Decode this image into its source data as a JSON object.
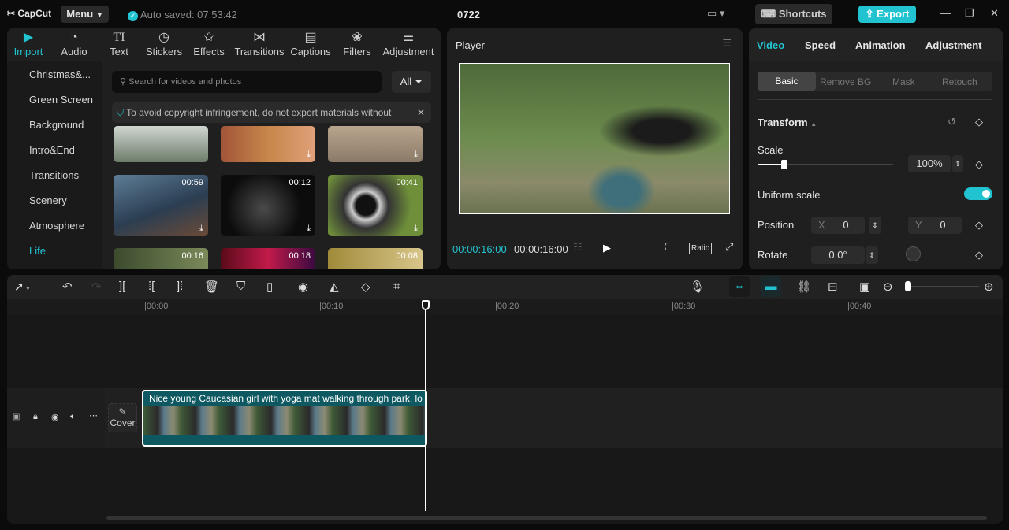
{
  "app": {
    "logo": "CapCut",
    "menu": "Menu",
    "autosave": "Auto saved: 07:53:42",
    "title": "0722",
    "shortcuts": "Shortcuts",
    "export": "Export"
  },
  "media_tabs": [
    {
      "label": "Import",
      "icon": "import-icon"
    },
    {
      "label": "Audio",
      "icon": "audio-icon"
    },
    {
      "label": "Text",
      "icon": "text-icon"
    },
    {
      "label": "Stickers",
      "icon": "stickers-icon"
    },
    {
      "label": "Effects",
      "icon": "effects-icon"
    },
    {
      "label": "Transitions",
      "icon": "transitions-icon"
    },
    {
      "label": "Captions",
      "icon": "captions-icon"
    },
    {
      "label": "Filters",
      "icon": "filters-icon"
    },
    {
      "label": "Adjustment",
      "icon": "adjustment-icon"
    }
  ],
  "sidebar": [
    "Christmas&...",
    "Green Screen",
    "Background",
    "Intro&End",
    "Transitions",
    "Scenery",
    "Atmosphere",
    "Life"
  ],
  "search": {
    "placeholder": "Search for videos and photos",
    "filter": "All"
  },
  "notice": "To avoid copyright infringement, do not export materials without",
  "thumbs": [
    {
      "dur": ""
    },
    {
      "dur": ""
    },
    {
      "dur": ""
    },
    {
      "dur": "00:59"
    },
    {
      "dur": "00:12"
    },
    {
      "dur": "00:41"
    },
    {
      "dur": "00:16"
    },
    {
      "dur": "00:18"
    },
    {
      "dur": "00:08"
    }
  ],
  "player": {
    "title": "Player",
    "current": "00:00:16:00",
    "total": "00:00:16:00",
    "ratio": "Ratio"
  },
  "props": {
    "tabs": [
      "Video",
      "Speed",
      "Animation",
      "Adjustment"
    ],
    "subtabs": [
      "Basic",
      "Remove BG",
      "Mask",
      "Retouch"
    ],
    "section": "Transform",
    "scale_label": "Scale",
    "scale_value": "100%",
    "scale_fraction": 0.2,
    "uniform": "Uniform scale",
    "uniform_on": true,
    "position_label": "Position",
    "x_label": "X",
    "x": "0",
    "y_label": "Y",
    "y": "0",
    "rotate_label": "Rotate",
    "rotate": "0.0°"
  },
  "ruler": [
    "|00:00",
    "|00:10",
    "|00:20",
    "|00:30",
    "|00:40"
  ],
  "clip": {
    "title": "Nice young Caucasian girl with yoga mat walking through park, lo"
  },
  "cover": "Cover",
  "colors": {
    "accent": "#22c3d0",
    "clip": "#0e5961"
  }
}
